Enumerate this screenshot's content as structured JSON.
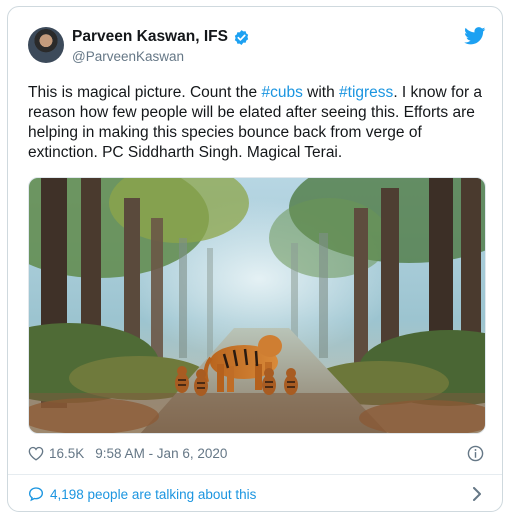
{
  "tweet": {
    "author_name": "Parveen Kaswan, IFS",
    "handle": "@ParveenKaswan",
    "text": {
      "part1": "This is magical picture. Count the ",
      "tag1": "#cubs",
      "part2": " with ",
      "tag2": "#tigress",
      "part3": ". I know for a reason how few people will be elated after seeing this. Efforts are helping in making this species bounce back from verge of extinction. PC Siddharth Singh. Magical Terai."
    },
    "likes": "16.5K",
    "timestamp": "9:58 AM - Jan 6, 2020",
    "talking": "4,198 people are talking about this"
  },
  "icons": {
    "verified": "verified-badge-icon",
    "brand": "twitter-bird-icon",
    "like": "heart-icon",
    "info": "info-icon",
    "reply": "speech-bubble-icon",
    "more": "chevron-right-icon"
  },
  "colors": {
    "accent": "#1b95e0",
    "verified": "#1da1f2",
    "muted": "#657786",
    "text": "#14171a",
    "border": "#cfd9de"
  }
}
